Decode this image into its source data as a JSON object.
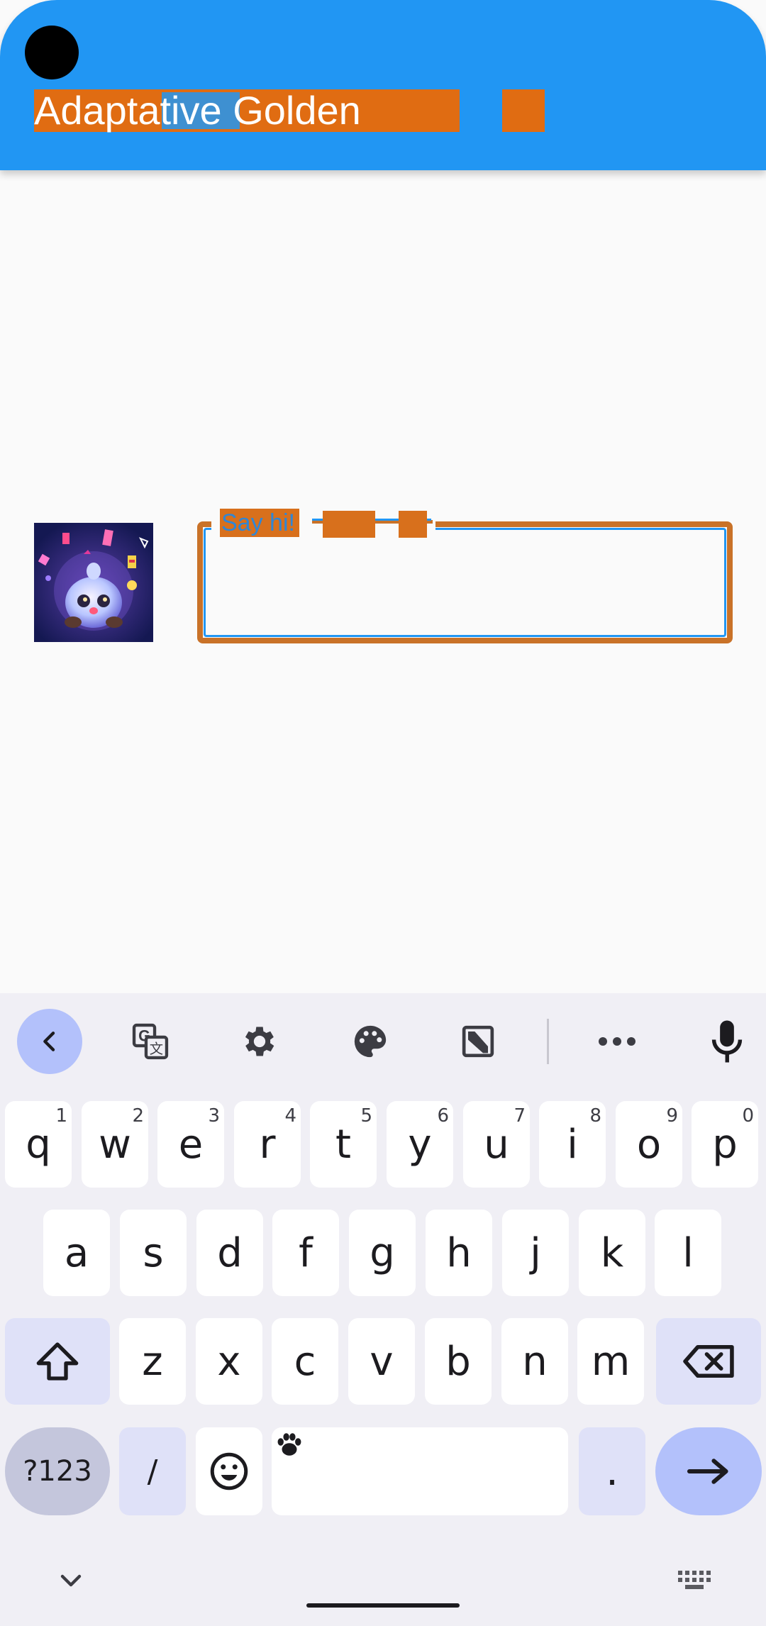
{
  "app_bar": {
    "title": "Adaptative Golden",
    "background": "#2196f3",
    "highlight": "#e06c12"
  },
  "content": {
    "avatar_icon": "character-avatar-image",
    "text_field": {
      "label": "Say hi!",
      "value": ""
    }
  },
  "keyboard": {
    "toolbar": [
      "chevron-left-icon",
      "translate-icon",
      "gear-icon",
      "palette-icon",
      "floating-keyboard-icon",
      "more-icon",
      "microphone-icon"
    ],
    "rows": [
      [
        {
          "k": "q",
          "s": "1"
        },
        {
          "k": "w",
          "s": "2"
        },
        {
          "k": "e",
          "s": "3"
        },
        {
          "k": "r",
          "s": "4"
        },
        {
          "k": "t",
          "s": "5"
        },
        {
          "k": "y",
          "s": "6"
        },
        {
          "k": "u",
          "s": "7"
        },
        {
          "k": "i",
          "s": "8"
        },
        {
          "k": "o",
          "s": "9"
        },
        {
          "k": "p",
          "s": "0"
        }
      ],
      [
        {
          "k": "a"
        },
        {
          "k": "s"
        },
        {
          "k": "d"
        },
        {
          "k": "f"
        },
        {
          "k": "g"
        },
        {
          "k": "h"
        },
        {
          "k": "j"
        },
        {
          "k": "k"
        },
        {
          "k": "l"
        }
      ],
      [
        {
          "k": "z"
        },
        {
          "k": "x"
        },
        {
          "k": "c"
        },
        {
          "k": "v"
        },
        {
          "k": "b"
        },
        {
          "k": "n"
        },
        {
          "k": "m"
        }
      ]
    ],
    "bottom": {
      "symbols_label": "?123",
      "slash_label": "/",
      "period_label": "."
    },
    "accent": "#b3c1fb"
  }
}
